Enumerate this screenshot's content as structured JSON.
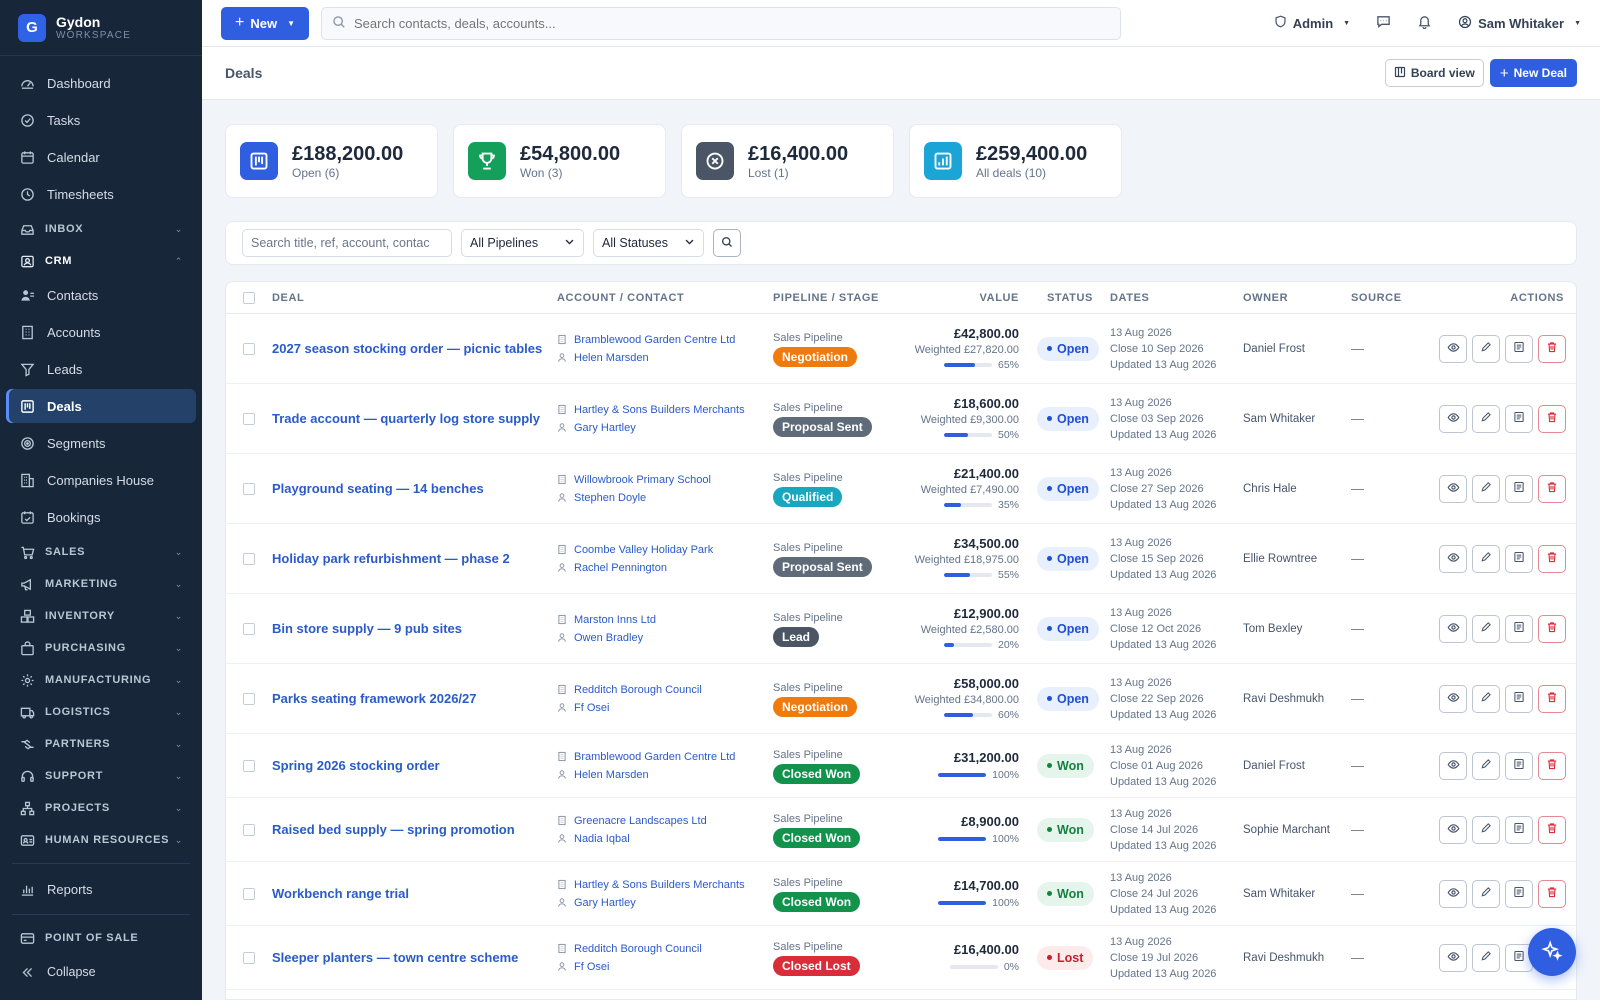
{
  "brand": {
    "name": "Gydon",
    "sub": "WORKSPACE",
    "initial": "G"
  },
  "nav": {
    "top": [
      {
        "label": "Dashboard",
        "icon": "dashboard-icon"
      },
      {
        "label": "Tasks",
        "icon": "tasks-icon"
      },
      {
        "label": "Calendar",
        "icon": "calendar-icon"
      },
      {
        "label": "Timesheets",
        "icon": "clock-icon"
      }
    ],
    "inbox": "INBOX",
    "crm": "CRM",
    "crm_items": [
      {
        "label": "Contacts",
        "icon": "contacts-icon"
      },
      {
        "label": "Accounts",
        "icon": "building-icon"
      },
      {
        "label": "Leads",
        "icon": "funnel-icon"
      },
      {
        "label": "Deals",
        "icon": "deals-icon"
      },
      {
        "label": "Segments",
        "icon": "target-icon"
      },
      {
        "label": "Companies House",
        "icon": "companies-icon"
      },
      {
        "label": "Bookings",
        "icon": "booking-icon"
      }
    ],
    "groups": [
      {
        "label": "SALES",
        "icon": "cart-icon"
      },
      {
        "label": "MARKETING",
        "icon": "megaphone-icon"
      },
      {
        "label": "INVENTORY",
        "icon": "boxes-icon"
      },
      {
        "label": "PURCHASING",
        "icon": "bag-icon"
      },
      {
        "label": "MANUFACTURING",
        "icon": "gear-icon"
      },
      {
        "label": "LOGISTICS",
        "icon": "truck-icon"
      },
      {
        "label": "PARTNERS",
        "icon": "handshake-icon"
      },
      {
        "label": "SUPPORT",
        "icon": "headset-icon"
      },
      {
        "label": "PROJECTS",
        "icon": "sitemap-icon"
      },
      {
        "label": "HUMAN RESOURCES",
        "icon": "id-card-icon"
      }
    ],
    "reports": "Reports",
    "pos": "POINT OF SALE",
    "collapse": "Collapse"
  },
  "topbar": {
    "new_label": "New",
    "search_placeholder": "Search contacts, deals, accounts...",
    "role": "Admin",
    "user": "Sam Whitaker"
  },
  "page": {
    "title": "Deals",
    "board_view": "Board view",
    "new_deal": "New Deal"
  },
  "stats": [
    {
      "value": "£188,200.00",
      "label": "Open (6)",
      "color": "#2f5fe0",
      "icon": "kanban-icon"
    },
    {
      "value": "£54,800.00",
      "label": "Won (3)",
      "color": "#14a05a",
      "icon": "trophy-icon"
    },
    {
      "value": "£16,400.00",
      "label": "Lost (1)",
      "color": "#4a5566",
      "icon": "x-circle-icon"
    },
    {
      "value": "£259,400.00",
      "label": "All deals (10)",
      "color": "#1aa5d6",
      "icon": "bar-chart-icon"
    }
  ],
  "filters": {
    "search_placeholder": "Search title, ref, account, contac",
    "pipeline": "All Pipelines",
    "status": "All Statuses"
  },
  "table": {
    "headers": {
      "deal": "DEAL",
      "account": "ACCOUNT / CONTACT",
      "pipeline": "PIPELINE / STAGE",
      "value": "VALUE",
      "status": "STATUS",
      "dates": "DATES",
      "owner": "OWNER",
      "source": "SOURCE",
      "actions": "ACTIONS"
    },
    "rows": [
      {
        "title": "2027 season stocking order — picnic tables",
        "account": "Bramblewood Garden Centre Ltd",
        "contact": "Helen Marsden",
        "pipeline": "Sales Pipeline",
        "stage": "Negotiation",
        "stage_kind": "negotiation",
        "value": "£42,800.00",
        "weighted": "Weighted £27,820.00",
        "pct": "65%",
        "pct_num": 65,
        "status": "Open",
        "status_kind": "open",
        "created": "13 Aug 2026",
        "close": "Close 10 Sep 2026",
        "updated": "Updated 13 Aug 2026",
        "owner": "Daniel Frost",
        "source": "—"
      },
      {
        "title": "Trade account — quarterly log store supply",
        "account": "Hartley & Sons Builders Merchants",
        "contact": "Gary Hartley",
        "pipeline": "Sales Pipeline",
        "stage": "Proposal Sent",
        "stage_kind": "proposal",
        "value": "£18,600.00",
        "weighted": "Weighted £9,300.00",
        "pct": "50%",
        "pct_num": 50,
        "status": "Open",
        "status_kind": "open",
        "created": "13 Aug 2026",
        "close": "Close 03 Sep 2026",
        "updated": "Updated 13 Aug 2026",
        "owner": "Sam Whitaker",
        "source": "—"
      },
      {
        "title": "Playground seating — 14 benches",
        "account": "Willowbrook Primary School",
        "contact": "Stephen Doyle",
        "pipeline": "Sales Pipeline",
        "stage": "Qualified",
        "stage_kind": "qualified",
        "value": "£21,400.00",
        "weighted": "Weighted £7,490.00",
        "pct": "35%",
        "pct_num": 35,
        "status": "Open",
        "status_kind": "open",
        "created": "13 Aug 2026",
        "close": "Close 27 Sep 2026",
        "updated": "Updated 13 Aug 2026",
        "owner": "Chris Hale",
        "source": "—"
      },
      {
        "title": "Holiday park refurbishment — phase 2",
        "account": "Coombe Valley Holiday Park",
        "contact": "Rachel Pennington",
        "pipeline": "Sales Pipeline",
        "stage": "Proposal Sent",
        "stage_kind": "proposal",
        "value": "£34,500.00",
        "weighted": "Weighted £18,975.00",
        "pct": "55%",
        "pct_num": 55,
        "status": "Open",
        "status_kind": "open",
        "created": "13 Aug 2026",
        "close": "Close 15 Sep 2026",
        "updated": "Updated 13 Aug 2026",
        "owner": "Ellie Rowntree",
        "source": "—"
      },
      {
        "title": "Bin store supply — 9 pub sites",
        "account": "Marston Inns Ltd",
        "contact": "Owen Bradley",
        "pipeline": "Sales Pipeline",
        "stage": "Lead",
        "stage_kind": "lead",
        "value": "£12,900.00",
        "weighted": "Weighted £2,580.00",
        "pct": "20%",
        "pct_num": 20,
        "status": "Open",
        "status_kind": "open",
        "created": "13 Aug 2026",
        "close": "Close 12 Oct 2026",
        "updated": "Updated 13 Aug 2026",
        "owner": "Tom Bexley",
        "source": "—"
      },
      {
        "title": "Parks seating framework 2026/27",
        "account": "Redditch Borough Council",
        "contact": "Ff Osei",
        "pipeline": "Sales Pipeline",
        "stage": "Negotiation",
        "stage_kind": "negotiation",
        "value": "£58,000.00",
        "weighted": "Weighted £34,800.00",
        "pct": "60%",
        "pct_num": 60,
        "status": "Open",
        "status_kind": "open",
        "created": "13 Aug 2026",
        "close": "Close 22 Sep 2026",
        "updated": "Updated 13 Aug 2026",
        "owner": "Ravi Deshmukh",
        "source": "—"
      },
      {
        "title": "Spring 2026 stocking order",
        "account": "Bramblewood Garden Centre Ltd",
        "contact": "Helen Marsden",
        "pipeline": "Sales Pipeline",
        "stage": "Closed Won",
        "stage_kind": "won",
        "value": "£31,200.00",
        "weighted": "",
        "pct": "100%",
        "pct_num": 100,
        "status": "Won",
        "status_kind": "won",
        "created": "13 Aug 2026",
        "close": "Close 01 Aug 2026",
        "updated": "Updated 13 Aug 2026",
        "owner": "Daniel Frost",
        "source": "—"
      },
      {
        "title": "Raised bed supply — spring promotion",
        "account": "Greenacre Landscapes Ltd",
        "contact": "Nadia Iqbal",
        "pipeline": "Sales Pipeline",
        "stage": "Closed Won",
        "stage_kind": "won",
        "value": "£8,900.00",
        "weighted": "",
        "pct": "100%",
        "pct_num": 100,
        "status": "Won",
        "status_kind": "won",
        "created": "13 Aug 2026",
        "close": "Close 14 Jul 2026",
        "updated": "Updated 13 Aug 2026",
        "owner": "Sophie Marchant",
        "source": "—"
      },
      {
        "title": "Workbench range trial",
        "account": "Hartley & Sons Builders Merchants",
        "contact": "Gary Hartley",
        "pipeline": "Sales Pipeline",
        "stage": "Closed Won",
        "stage_kind": "won",
        "value": "£14,700.00",
        "weighted": "",
        "pct": "100%",
        "pct_num": 100,
        "status": "Won",
        "status_kind": "won",
        "created": "13 Aug 2026",
        "close": "Close 24 Jul 2026",
        "updated": "Updated 13 Aug 2026",
        "owner": "Sam Whitaker",
        "source": "—"
      },
      {
        "title": "Sleeper planters — town centre scheme",
        "account": "Redditch Borough Council",
        "contact": "Ff Osei",
        "pipeline": "Sales Pipeline",
        "stage": "Closed Lost",
        "stage_kind": "lost",
        "value": "£16,400.00",
        "weighted": "",
        "pct": "0%",
        "pct_num": 0,
        "status": "Lost",
        "status_kind": "lost",
        "created": "13 Aug 2026",
        "close": "Close 19 Jul 2026",
        "updated": "Updated 13 Aug 2026",
        "owner": "Ravi Deshmukh",
        "source": "—"
      }
    ]
  }
}
